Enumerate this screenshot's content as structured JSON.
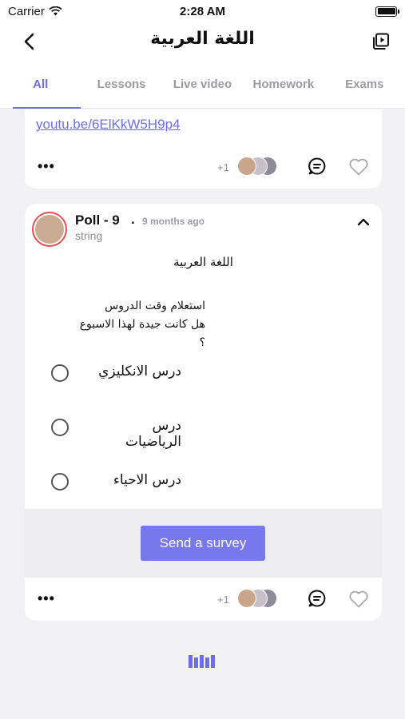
{
  "status_bar": {
    "carrier": "Carrier",
    "time": "2:28 AM"
  },
  "nav": {
    "title": "اللغة العربية"
  },
  "tabs": [
    {
      "label": "All",
      "active": true
    },
    {
      "label": "Lessons",
      "active": false
    },
    {
      "label": "Live video",
      "active": false
    },
    {
      "label": "Homework",
      "active": false
    },
    {
      "label": "Exams",
      "active": false
    }
  ],
  "top_card": {
    "link": "youtu.be/6ElKkW5H9p4",
    "likes_extra": "+1"
  },
  "poll": {
    "title": "Poll - 9",
    "separator": ".",
    "time": "9 months ago",
    "subtitle": "string",
    "heading": "اللغة العربية",
    "question_line1": "استعلام وقت الدروس",
    "question_line2": "هل كانت جيدة لهذا الاسبوع ؟",
    "options": [
      "درس الانكليزي",
      "درس الرياضيات",
      "درس الاحياء"
    ],
    "button": "Send a survey",
    "likes_extra": "+1"
  },
  "colors": {
    "accent": "#6e6ee8",
    "button": "#7777ee",
    "avatar_ring": "#e05050"
  },
  "icons": [
    "back-chevron-icon",
    "video-library-icon",
    "wifi-icon",
    "battery-icon",
    "more-dots-icon",
    "comment-icon",
    "heart-icon",
    "chevron-up-icon",
    "loader-icon"
  ]
}
